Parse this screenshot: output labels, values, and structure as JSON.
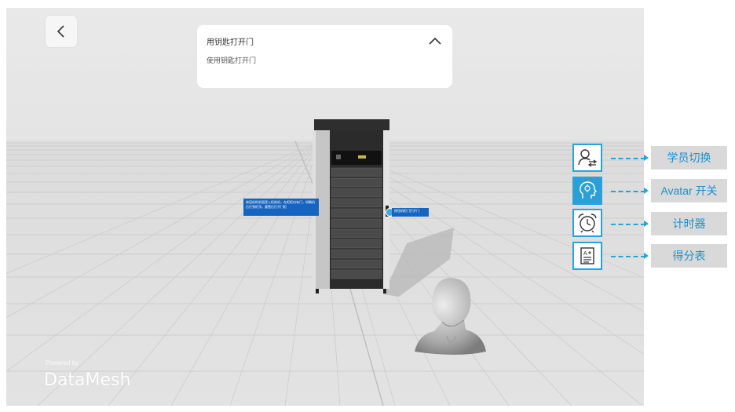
{
  "task": {
    "title": "用钥匙打开门",
    "subtitle": "使用钥匙打开门"
  },
  "nav": {
    "back_icon": "chevron-left-icon",
    "collapse_icon": "chevron-up-icon"
  },
  "scene": {
    "tip_left_text": "按钮机柜前面是入柜前机，在柜柜内有门，如确机后打到柜顶，重置后打开门柜",
    "tip_right_text": "按钮机柜门打开门",
    "avatar": "avatar-head"
  },
  "brand": {
    "powered_by": "Powered by",
    "name": "DataMesh"
  },
  "tools": [
    {
      "icon": "user-switch-icon",
      "label": "学员切换",
      "active": false
    },
    {
      "icon": "avatar-toggle-icon",
      "label": "Avatar 开关",
      "active": true
    },
    {
      "icon": "alarm-clock-icon",
      "label": "计时器",
      "active": false
    },
    {
      "icon": "score-sheet-icon",
      "label": "得分表",
      "active": false
    }
  ],
  "colors": {
    "accent": "#29a3d8",
    "accent_fill": "#2b9fd6",
    "callout_bg": "#d9d9d9",
    "tip_bg": "#1565c0"
  }
}
